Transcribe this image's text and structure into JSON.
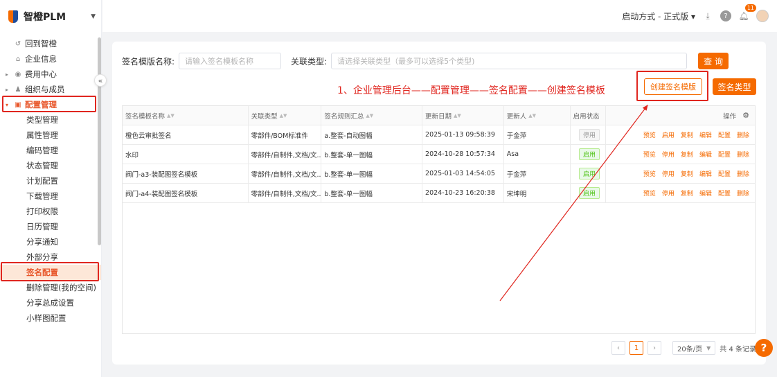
{
  "app": {
    "name": "智橙PLM"
  },
  "sidebar": {
    "top_items": [
      {
        "label": "回到智橙",
        "icon": "return-icon"
      },
      {
        "label": "企业信息",
        "icon": "home-icon"
      },
      {
        "label": "费用中心",
        "icon": "cost-icon"
      },
      {
        "label": "组织与成员",
        "icon": "users-icon"
      }
    ],
    "group": {
      "label": "配置管理",
      "icon": "config-icon"
    },
    "sub_items": [
      "类型管理",
      "属性管理",
      "编码管理",
      "状态管理",
      "计划配置",
      "下载管理",
      "打印权限",
      "日历管理",
      "分享通知",
      "外部分享",
      "签名配置",
      "删除管理(我的空间)",
      "分享总成设置",
      "小样图配置"
    ],
    "active_sub": "签名配置"
  },
  "topbar": {
    "mode_label": "启动方式 - 正式版",
    "notification_count": "11"
  },
  "search": {
    "name_label": "签名模版名称:",
    "name_placeholder": "请输入签名模板名称",
    "type_label": "关联类型:",
    "type_placeholder": "请选择关联类型（最多可以选择5个类型)",
    "query_button": "查 询"
  },
  "annotation": "1、企业管理后台——配置管理——签名配置——创建签名模板",
  "buttons": {
    "create": "创建签名模版",
    "types": "签名类型"
  },
  "table": {
    "headers": [
      "签名模板名称",
      "关联类型",
      "签名规则汇总",
      "更新日期",
      "更新人",
      "启用状态",
      "操作"
    ],
    "rows": [
      {
        "name": "橙色云审批签名",
        "type": "零部件/BOM标准件",
        "rule": "a.整套-自动图幅",
        "date": "2025-01-13 09:58:39",
        "user": "于金萍",
        "status": "停用",
        "actions": [
          "预览",
          "启用",
          "复制",
          "编辑",
          "配置",
          "删除"
        ]
      },
      {
        "name": "水印",
        "type": "零部件/自制件,文档/文...",
        "rule": "b.整套-单一图幅",
        "date": "2024-10-28 10:57:34",
        "user": "Asa",
        "status": "启用",
        "actions": [
          "预览",
          "停用",
          "复制",
          "编辑",
          "配置",
          "删除"
        ]
      },
      {
        "name": "阀门-a3-装配图签名模板",
        "type": "零部件/自制件,文档/文...",
        "rule": "b.整套-单一图幅",
        "date": "2025-01-03 14:54:05",
        "user": "于金萍",
        "status": "启用",
        "actions": [
          "预览",
          "停用",
          "复制",
          "编辑",
          "配置",
          "删除"
        ]
      },
      {
        "name": "阀门-a4-装配图签名模板",
        "type": "零部件/自制件,文档/文...",
        "rule": "b.整套-单一图幅",
        "date": "2024-10-23 16:20:38",
        "user": "宋坤明",
        "status": "启用",
        "actions": [
          "预览",
          "停用",
          "复制",
          "编辑",
          "配置",
          "删除"
        ]
      }
    ]
  },
  "pagination": {
    "current": "1",
    "page_size": "20条/页",
    "total": "共 4 条记录"
  },
  "help_label": "?",
  "colors": {
    "accent": "#f56a00",
    "highlight": "#e0261f",
    "enabled": "#52c41a"
  }
}
